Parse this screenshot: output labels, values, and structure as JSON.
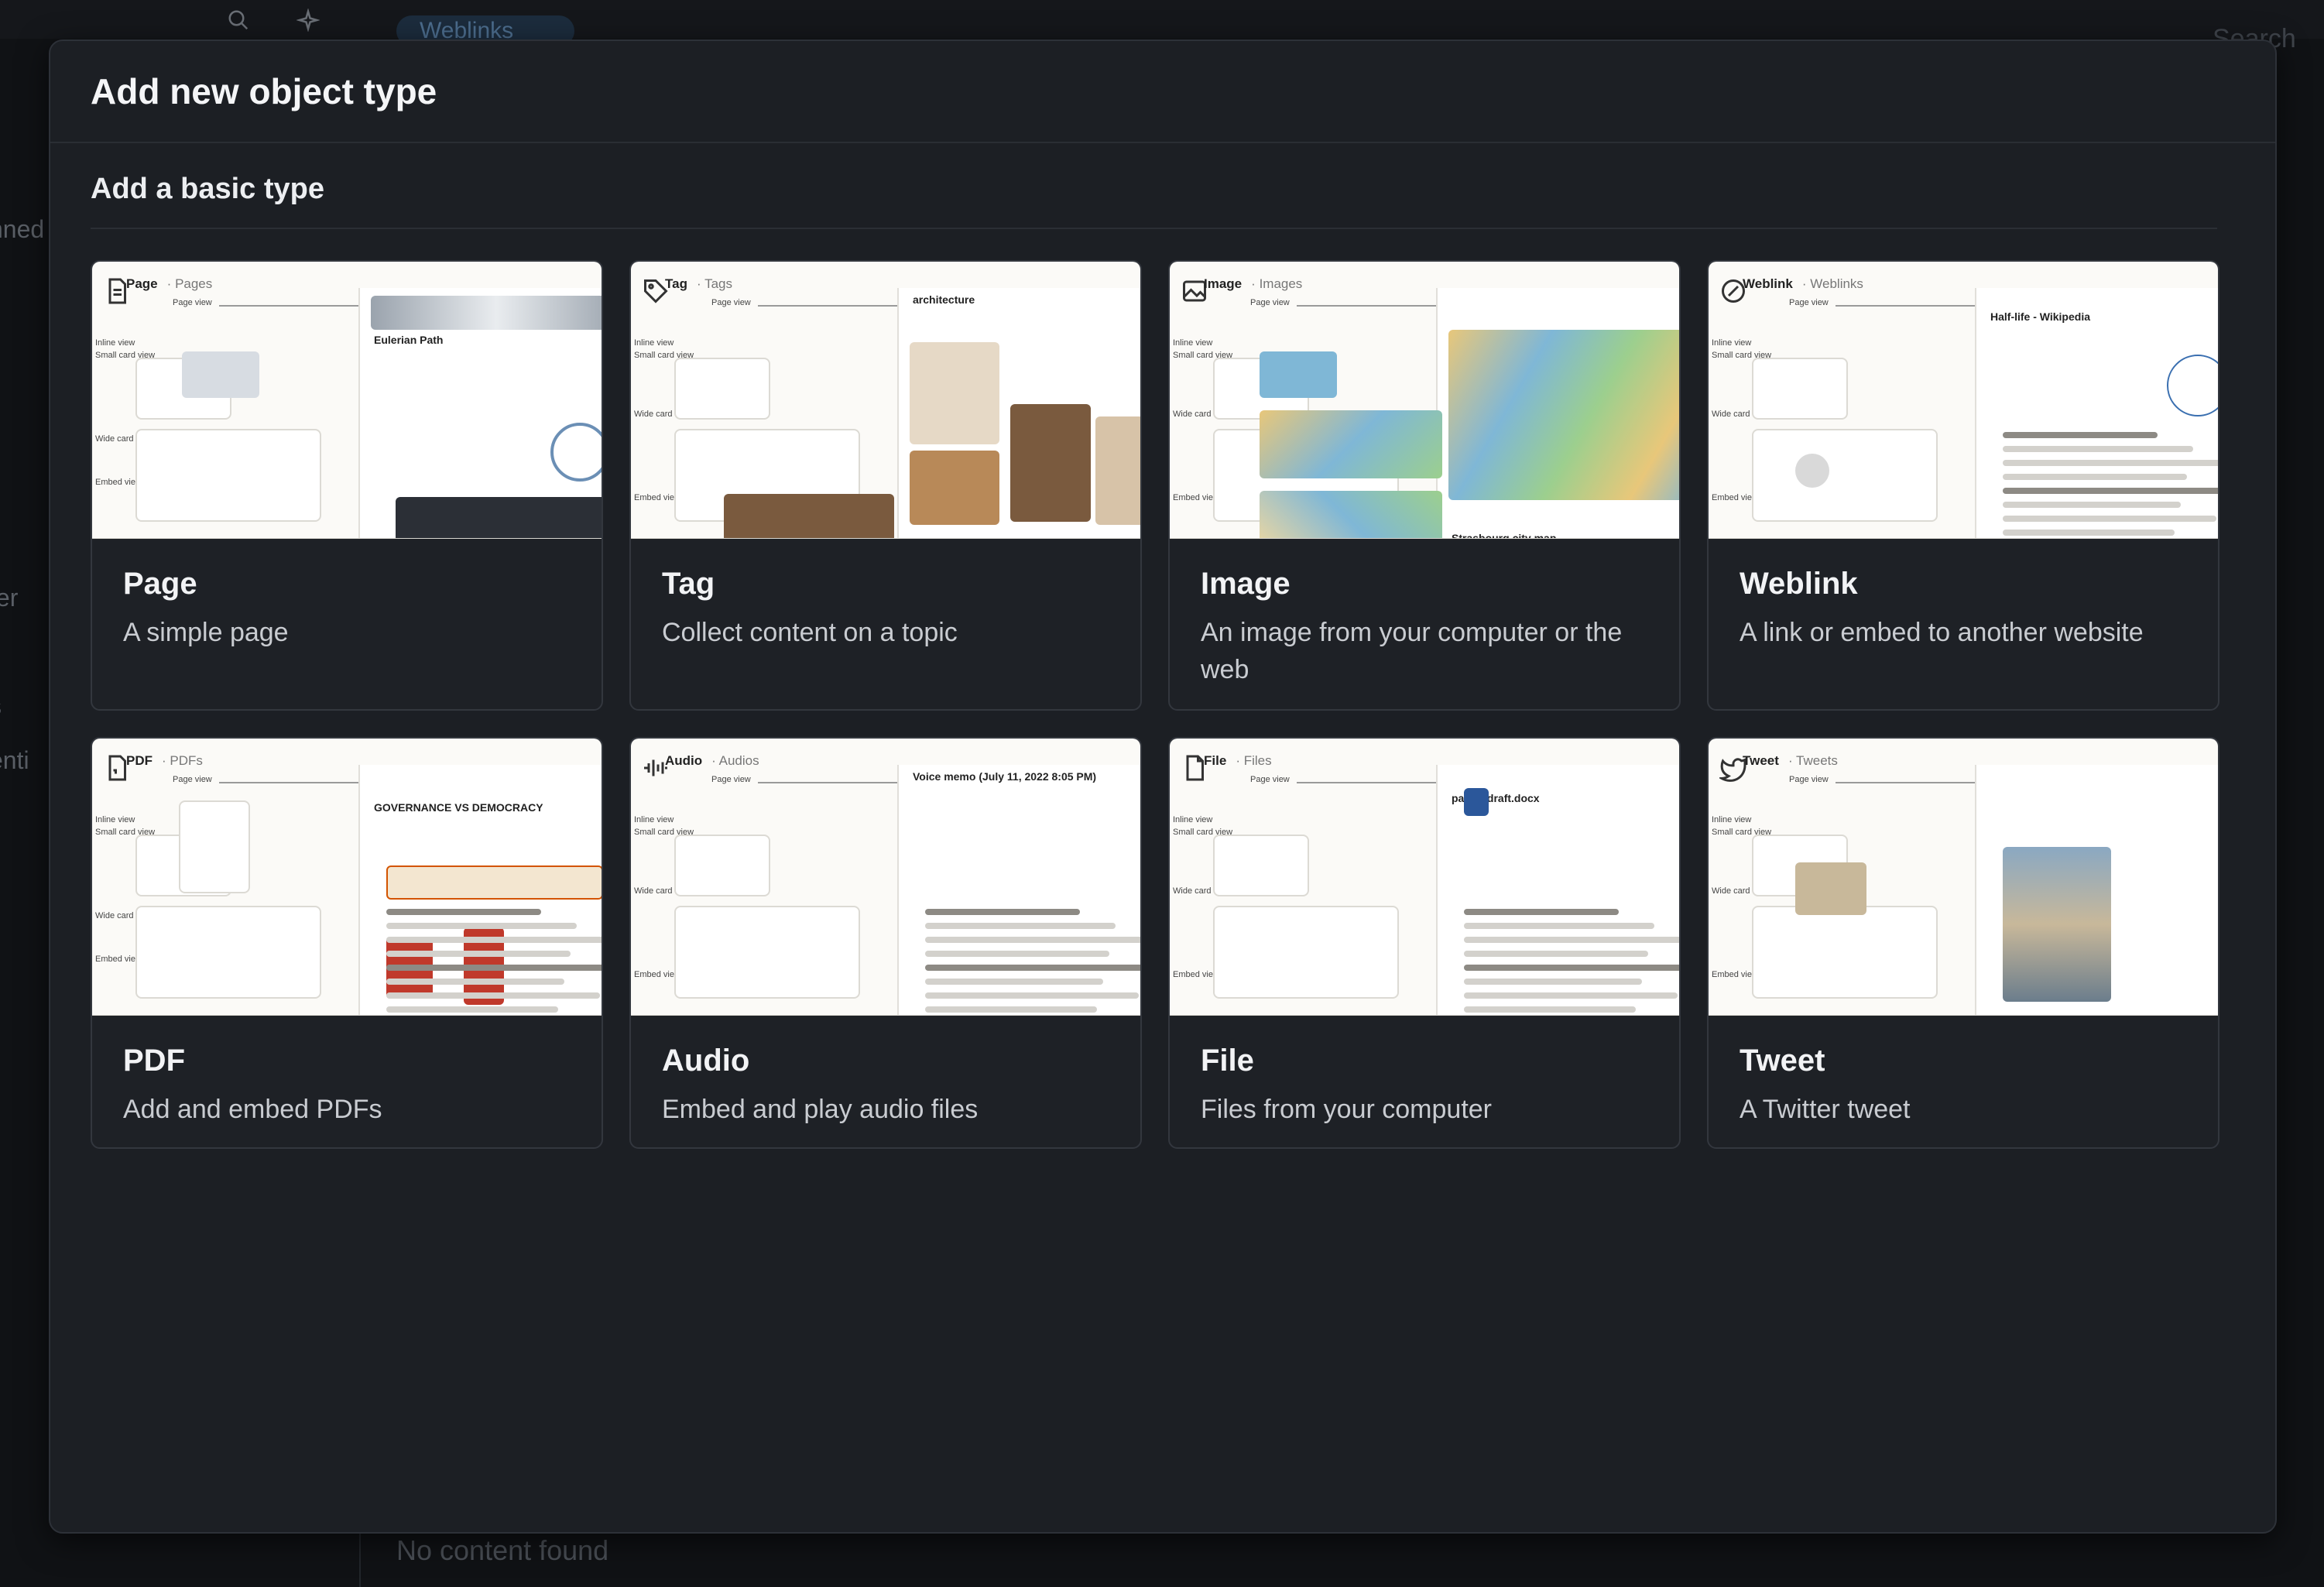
{
  "background": {
    "tab_label": "Weblinks",
    "search_label": "Search",
    "side_fragments": [
      "nned",
      "ter",
      "s",
      "enti"
    ],
    "no_content": "No content found"
  },
  "modal": {
    "title": "Add new object type",
    "section_title": "Add a basic type"
  },
  "preview_labels": {
    "page_view": "Page view",
    "inline_view": "Inline view",
    "small_card_view": "Small card view",
    "wide_card_view": "Wide card view",
    "embed_view": "Embed view"
  },
  "cards": [
    {
      "id": "page",
      "icon": "page-icon",
      "singular": "Page",
      "plural": "Pages",
      "name": "Page",
      "description": "A simple page",
      "preview_heading": "Eulerian Path"
    },
    {
      "id": "tag",
      "icon": "tag-icon",
      "singular": "Tag",
      "plural": "Tags",
      "name": "Tag",
      "description": "Collect content on a topic",
      "preview_heading": "architecture"
    },
    {
      "id": "image",
      "icon": "image-icon",
      "singular": "Image",
      "plural": "Images",
      "name": "Image",
      "description": "An image from your computer or the web",
      "preview_heading": "Strasbourg city map"
    },
    {
      "id": "weblink",
      "icon": "weblink-icon",
      "singular": "Weblink",
      "plural": "Weblinks",
      "name": "Weblink",
      "description": "A link or embed to another website",
      "preview_heading": "Half-life - Wikipedia"
    },
    {
      "id": "pdf",
      "icon": "pdf-icon",
      "singular": "PDF",
      "plural": "PDFs",
      "name": "PDF",
      "description": "Add and embed PDFs",
      "preview_heading": "GOVERNANCE VS DEMOCRACY"
    },
    {
      "id": "audio",
      "icon": "audio-icon",
      "singular": "Audio",
      "plural": "Audios",
      "name": "Audio",
      "description": "Embed and play audio files",
      "preview_heading": "Voice memo (July 11, 2022 8:05 PM)"
    },
    {
      "id": "file",
      "icon": "file-icon",
      "singular": "File",
      "plural": "Files",
      "name": "File",
      "description": "Files from your computer",
      "preview_heading": "paper_draft.docx"
    },
    {
      "id": "tweet",
      "icon": "tweet-icon",
      "singular": "Tweet",
      "plural": "Tweets",
      "name": "Tweet",
      "description": "A Twitter tweet",
      "preview_heading": ""
    }
  ]
}
